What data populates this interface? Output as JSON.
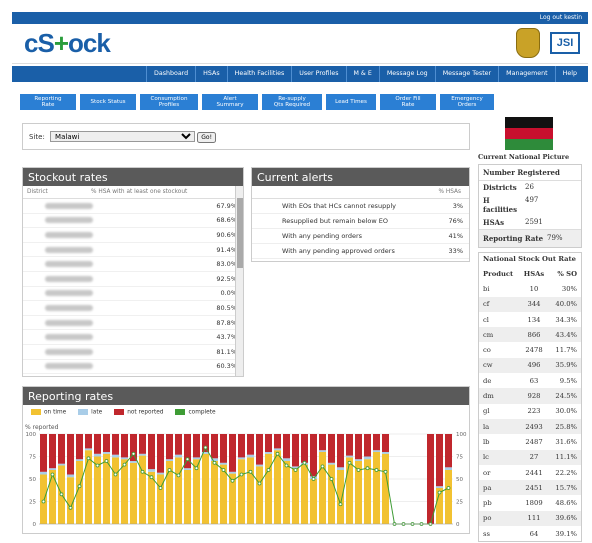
{
  "topbar": {
    "logout": "Log out kestin"
  },
  "brand": {
    "logo_prefix": "cS",
    "logo_plus": "+",
    "logo_suffix": "ock",
    "partner": "JSI"
  },
  "main_nav": [
    "Dashboard",
    "HSAs",
    "Health Facilities",
    "User Profiles",
    "M & E",
    "Message Log",
    "Message Tester",
    "Management",
    "Help"
  ],
  "sub_nav": [
    "Reporting\nRate",
    "Stock Status",
    "Consumption\nProfiles",
    "Alert\nSummary",
    "Re-supply\nQts Required",
    "Lead Times",
    "Order Fill\nRate",
    "Emergency\nOrders"
  ],
  "site": {
    "label": "Site:",
    "value": "Malawi",
    "go": "Go!"
  },
  "stockout": {
    "title": "Stockout rates",
    "col_district": "District",
    "col_pct": "% HSA with at least one stockout",
    "values": [
      "67.9%",
      "68.6%",
      "90.6%",
      "91.4%",
      "83.0%",
      "92.5%",
      "0.0%",
      "80.5%",
      "87.8%",
      "43.7%",
      "81.1%",
      "60.3%"
    ]
  },
  "alerts": {
    "title": "Current alerts",
    "col_pct": "% HSAs",
    "rows": [
      {
        "label": "With EOs that HCs cannot resupply",
        "value": "3%"
      },
      {
        "label": "Resupplied but remain below EO",
        "value": "76%"
      },
      {
        "label": "With any pending orders",
        "value": "41%"
      },
      {
        "label": "With any pending approved orders",
        "value": "33%"
      }
    ]
  },
  "national": {
    "title": "Current National Picture",
    "registered_title": "Number Registered",
    "registered": [
      {
        "label": "Districts",
        "value": "26"
      },
      {
        "label": "H facilities",
        "value": "497"
      },
      {
        "label": "HSAs",
        "value": "2591"
      }
    ],
    "reporting_label": "Reporting Rate",
    "reporting_value": "79%",
    "so_title": "National Stock Out Rate",
    "so_headers": [
      "Product",
      "HSAs",
      "% SO"
    ],
    "so_rows": [
      [
        "bi",
        "10",
        "30%"
      ],
      [
        "cf",
        "344",
        "40.0%"
      ],
      [
        "cl",
        "134",
        "34.3%"
      ],
      [
        "cm",
        "866",
        "43.4%"
      ],
      [
        "co",
        "2478",
        "11.7%"
      ],
      [
        "cw",
        "496",
        "35.9%"
      ],
      [
        "de",
        "63",
        "9.5%"
      ],
      [
        "dm",
        "928",
        "24.5%"
      ],
      [
        "gl",
        "223",
        "30.0%"
      ],
      [
        "la",
        "2493",
        "25.8%"
      ],
      [
        "lb",
        "2487",
        "31.6%"
      ],
      [
        "lc",
        "27",
        "11.1%"
      ],
      [
        "or",
        "2441",
        "22.2%"
      ],
      [
        "pa",
        "2451",
        "15.7%"
      ],
      [
        "pb",
        "1809",
        "48.6%"
      ],
      [
        "po",
        "111",
        "39.6%"
      ],
      [
        "ss",
        "64",
        "39.1%"
      ]
    ]
  },
  "reporting": {
    "title": "Reporting rates",
    "legend": [
      "on time",
      "late",
      "not reported",
      "complete"
    ],
    "ylabel": "% reported"
  },
  "chart_data": {
    "type": "bar",
    "title": "Reporting rates",
    "ylabel": "% reported",
    "ylim": [
      0,
      100
    ],
    "yticks": [
      0,
      25,
      50,
      75,
      100
    ],
    "colors": {
      "on time": "#f2c231",
      "late": "#a9cde8",
      "not reported": "#c0272d",
      "complete": "#3e9c35"
    },
    "series": [
      {
        "name": "on time",
        "values": [
          55,
          60,
          65,
          52,
          70,
          82,
          75,
          78,
          74,
          72,
          68,
          76,
          58,
          55,
          70,
          74,
          60,
          72,
          78,
          70,
          66,
          56,
          72,
          74,
          64,
          78,
          82,
          70,
          62,
          66,
          50,
          80,
          66,
          60,
          74,
          70,
          72,
          80,
          78,
          0,
          0,
          0,
          0,
          0,
          40,
          60
        ]
      },
      {
        "name": "late",
        "values": [
          3,
          2,
          2,
          3,
          2,
          2,
          3,
          2,
          3,
          2,
          2,
          2,
          3,
          2,
          2,
          3,
          2,
          2,
          2,
          3,
          2,
          2,
          2,
          3,
          2,
          2,
          2,
          3,
          2,
          2,
          3,
          2,
          2,
          3,
          2,
          2,
          3,
          2,
          2,
          0,
          0,
          0,
          0,
          0,
          2,
          3
        ]
      },
      {
        "name": "not reported",
        "values": [
          42,
          38,
          33,
          45,
          28,
          16,
          22,
          20,
          23,
          26,
          30,
          22,
          39,
          43,
          28,
          23,
          38,
          26,
          20,
          27,
          32,
          42,
          26,
          23,
          34,
          20,
          16,
          27,
          36,
          32,
          47,
          18,
          32,
          37,
          24,
          28,
          25,
          18,
          20,
          0,
          0,
          0,
          0,
          100,
          58,
          37
        ]
      },
      {
        "name": "complete",
        "values": [
          25,
          55,
          33,
          18,
          42,
          73,
          65,
          70,
          55,
          66,
          78,
          58,
          52,
          40,
          60,
          54,
          72,
          62,
          85,
          68,
          60,
          48,
          55,
          58,
          45,
          60,
          78,
          65,
          60,
          68,
          50,
          64,
          50,
          22,
          68,
          60,
          62,
          60,
          58,
          0,
          0,
          0,
          0,
          0,
          35,
          40
        ]
      }
    ]
  }
}
